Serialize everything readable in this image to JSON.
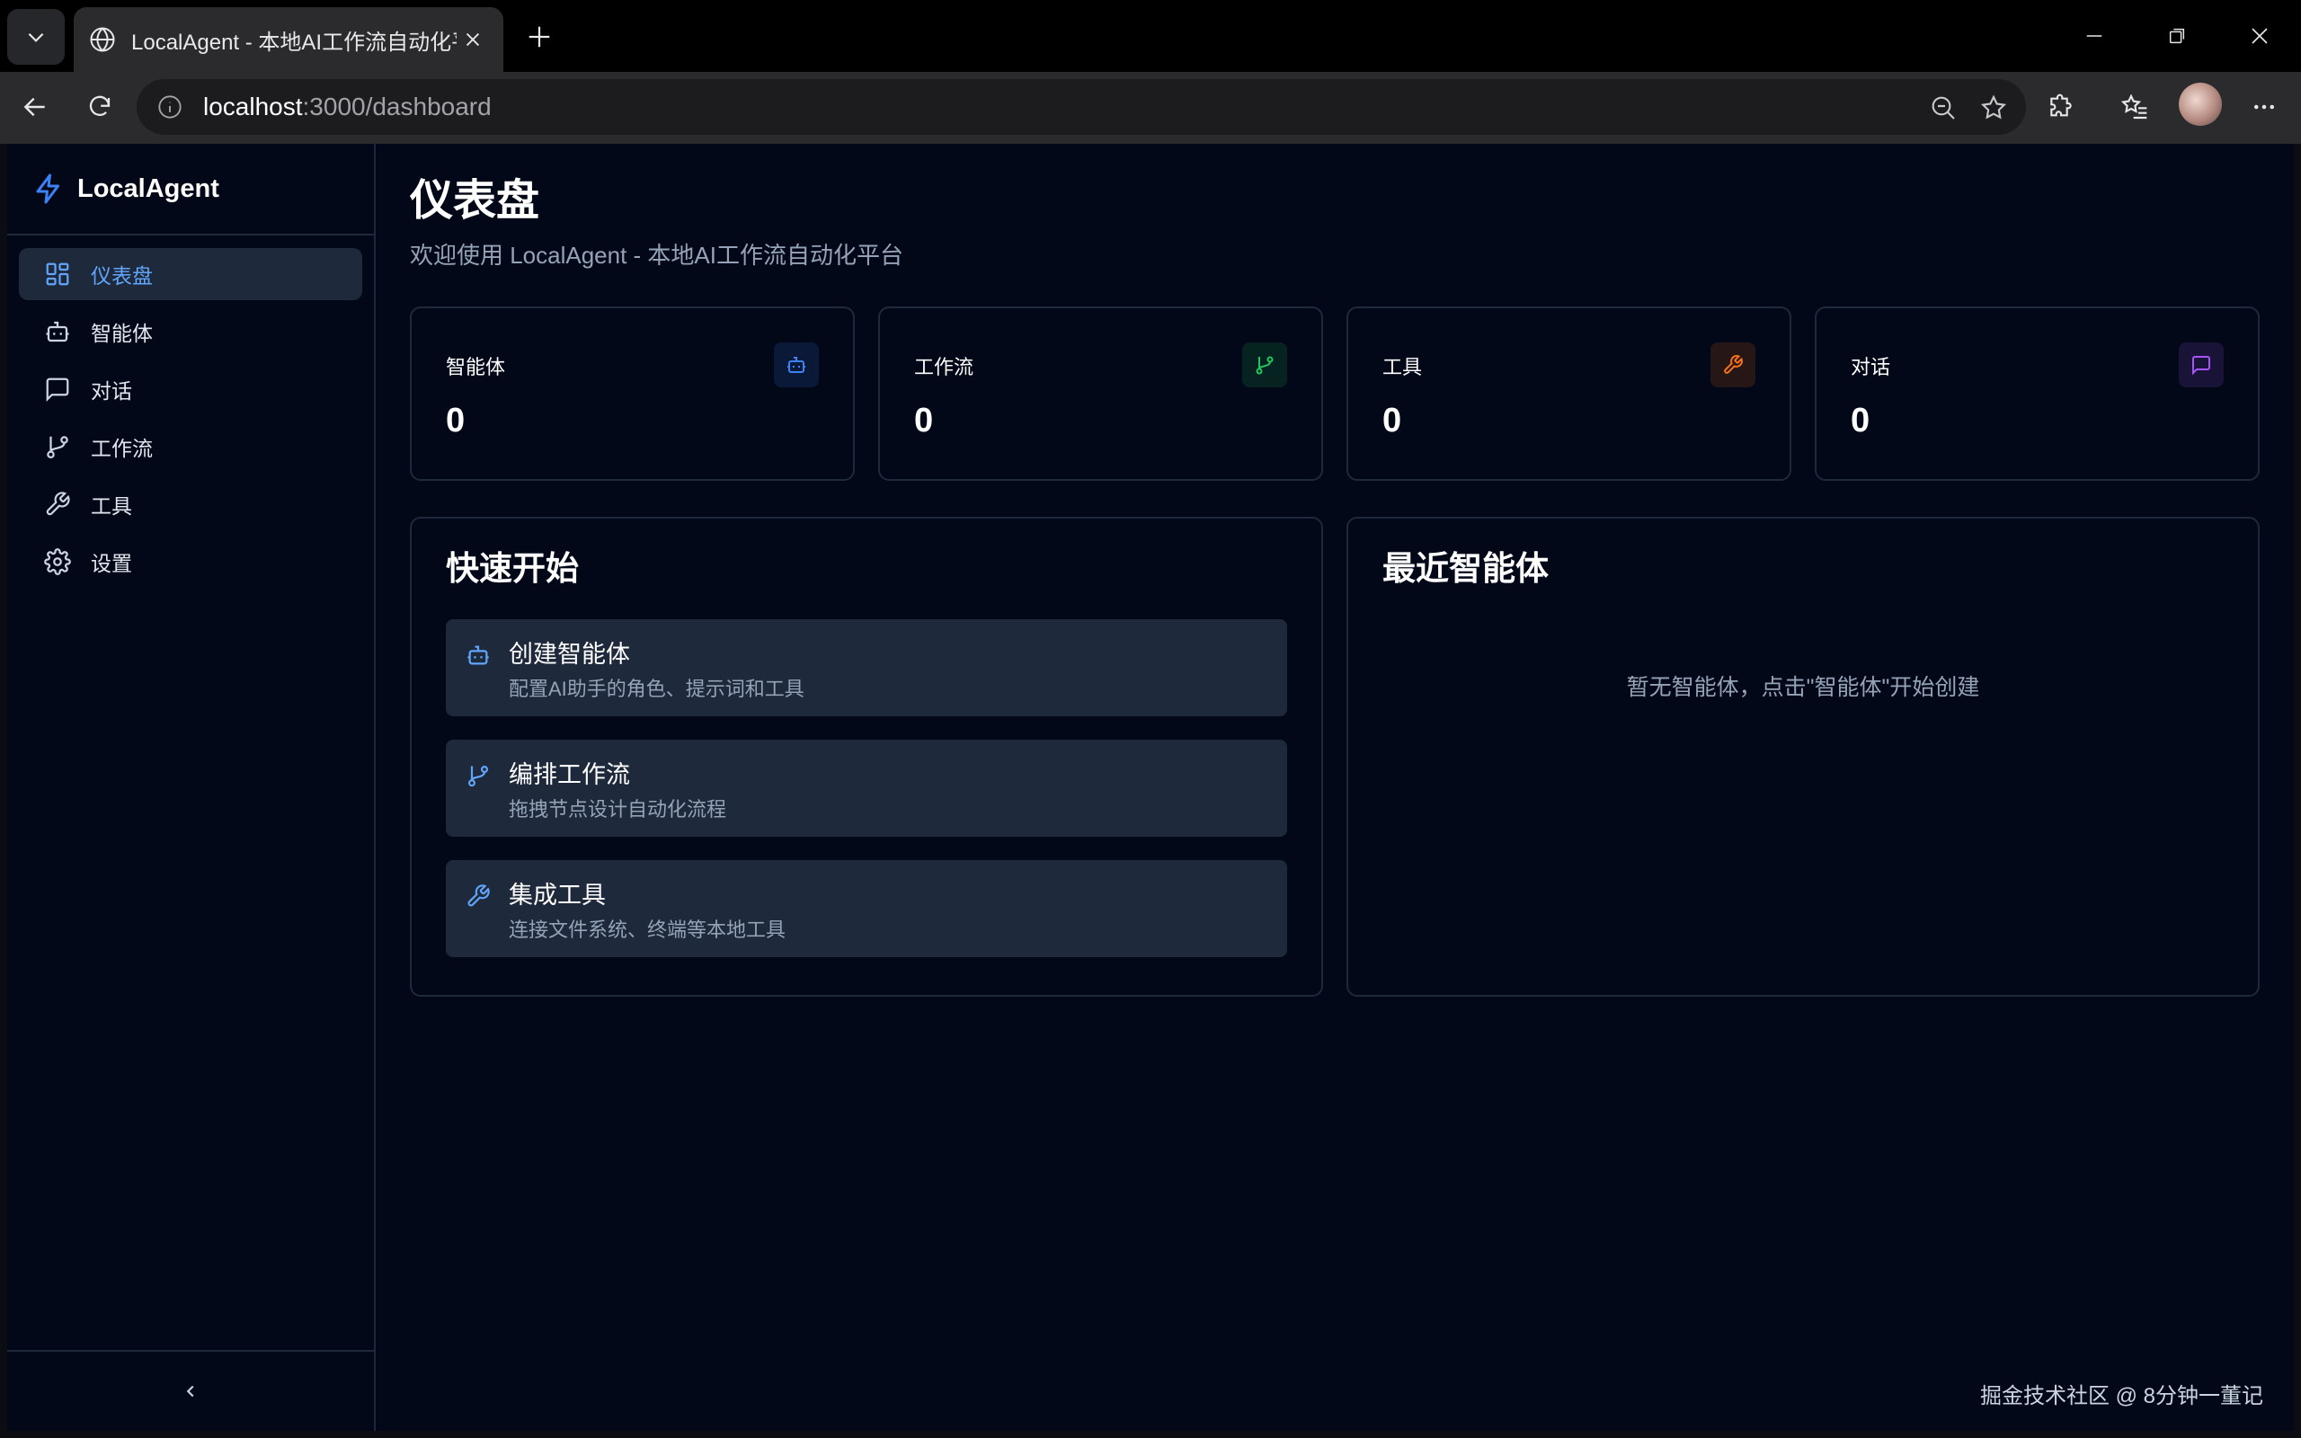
{
  "browser": {
    "tab_title": "LocalAgent - 本地AI工作流自动化平台",
    "url_host": "localhost",
    "url_path": ":3000/dashboard"
  },
  "sidebar": {
    "brand": "LocalAgent",
    "items": [
      {
        "label": "仪表盘",
        "icon": "dashboard-icon",
        "active": true
      },
      {
        "label": "智能体",
        "icon": "bot-icon"
      },
      {
        "label": "对话",
        "icon": "chat-icon"
      },
      {
        "label": "工作流",
        "icon": "workflow-icon"
      },
      {
        "label": "工具",
        "icon": "wrench-icon"
      },
      {
        "label": "设置",
        "icon": "gear-icon"
      }
    ],
    "collapse_glyph": "‹"
  },
  "header": {
    "title": "仪表盘",
    "subtitle": "欢迎使用 LocalAgent - 本地AI工作流自动化平台"
  },
  "stats": [
    {
      "label": "智能体",
      "value": "0",
      "icon": "bot-icon",
      "color": "#3b82f6"
    },
    {
      "label": "工作流",
      "value": "0",
      "icon": "workflow-icon",
      "color": "#22c55e"
    },
    {
      "label": "工具",
      "value": "0",
      "icon": "wrench-icon",
      "color": "#f97316"
    },
    {
      "label": "对话",
      "value": "0",
      "icon": "chat-icon",
      "color": "#a855f7"
    }
  ],
  "quick_start": {
    "title": "快速开始",
    "items": [
      {
        "title": "创建智能体",
        "desc": "配置AI助手的角色、提示词和工具",
        "icon": "bot-icon"
      },
      {
        "title": "编排工作流",
        "desc": "拖拽节点设计自动化流程",
        "icon": "workflow-icon"
      },
      {
        "title": "集成工具",
        "desc": "连接文件系统、终端等本地工具",
        "icon": "wrench-icon"
      }
    ]
  },
  "recent_agents": {
    "title": "最近智能体",
    "empty": "暂无智能体，点击\"智能体\"开始创建"
  },
  "watermark": "掘金技术社区 @ 8分钟一董记",
  "colors": {
    "accent": "#60a5fa",
    "background": "#020817",
    "border": "#1e293b"
  }
}
